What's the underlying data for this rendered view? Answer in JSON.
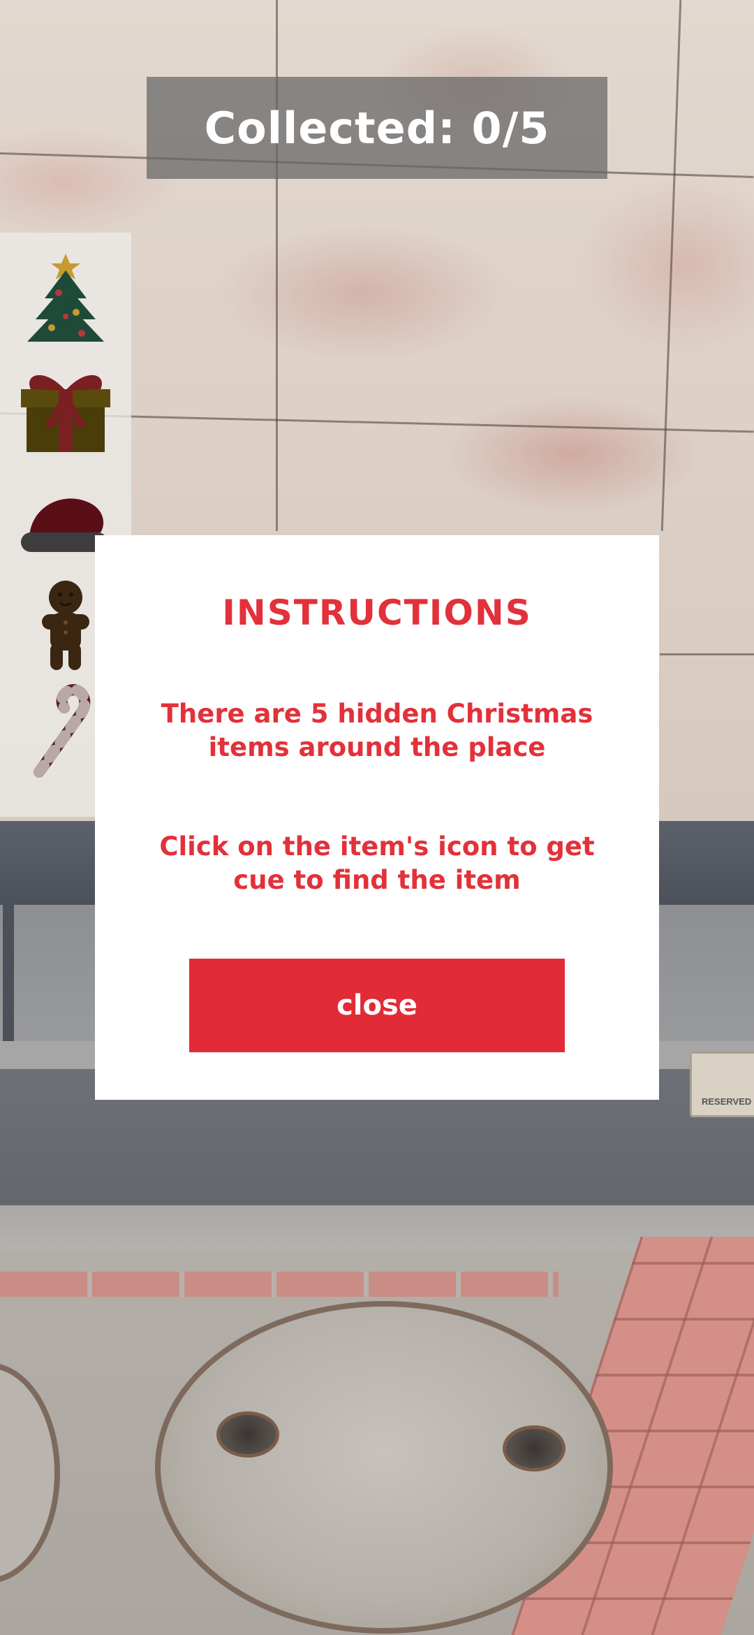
{
  "hud": {
    "collected_label": "Collected: 0/5"
  },
  "items": [
    {
      "icon": "christmas-tree-icon"
    },
    {
      "icon": "gift-box-icon"
    },
    {
      "icon": "santa-hat-icon"
    },
    {
      "icon": "gingerbread-man-icon"
    },
    {
      "icon": "candy-cane-icon"
    }
  ],
  "modal": {
    "title": "INSTRUCTIONS",
    "paragraph_1": "There are 5 hidden Christmas items around the place",
    "paragraph_2": "Click on the item's icon to get cue to find the item",
    "close_label": "close"
  },
  "sign": {
    "text": "RESERVED"
  },
  "colors": {
    "accent_red": "#e2313a",
    "button_red": "#e12b36",
    "counter_bg": "#646464"
  }
}
